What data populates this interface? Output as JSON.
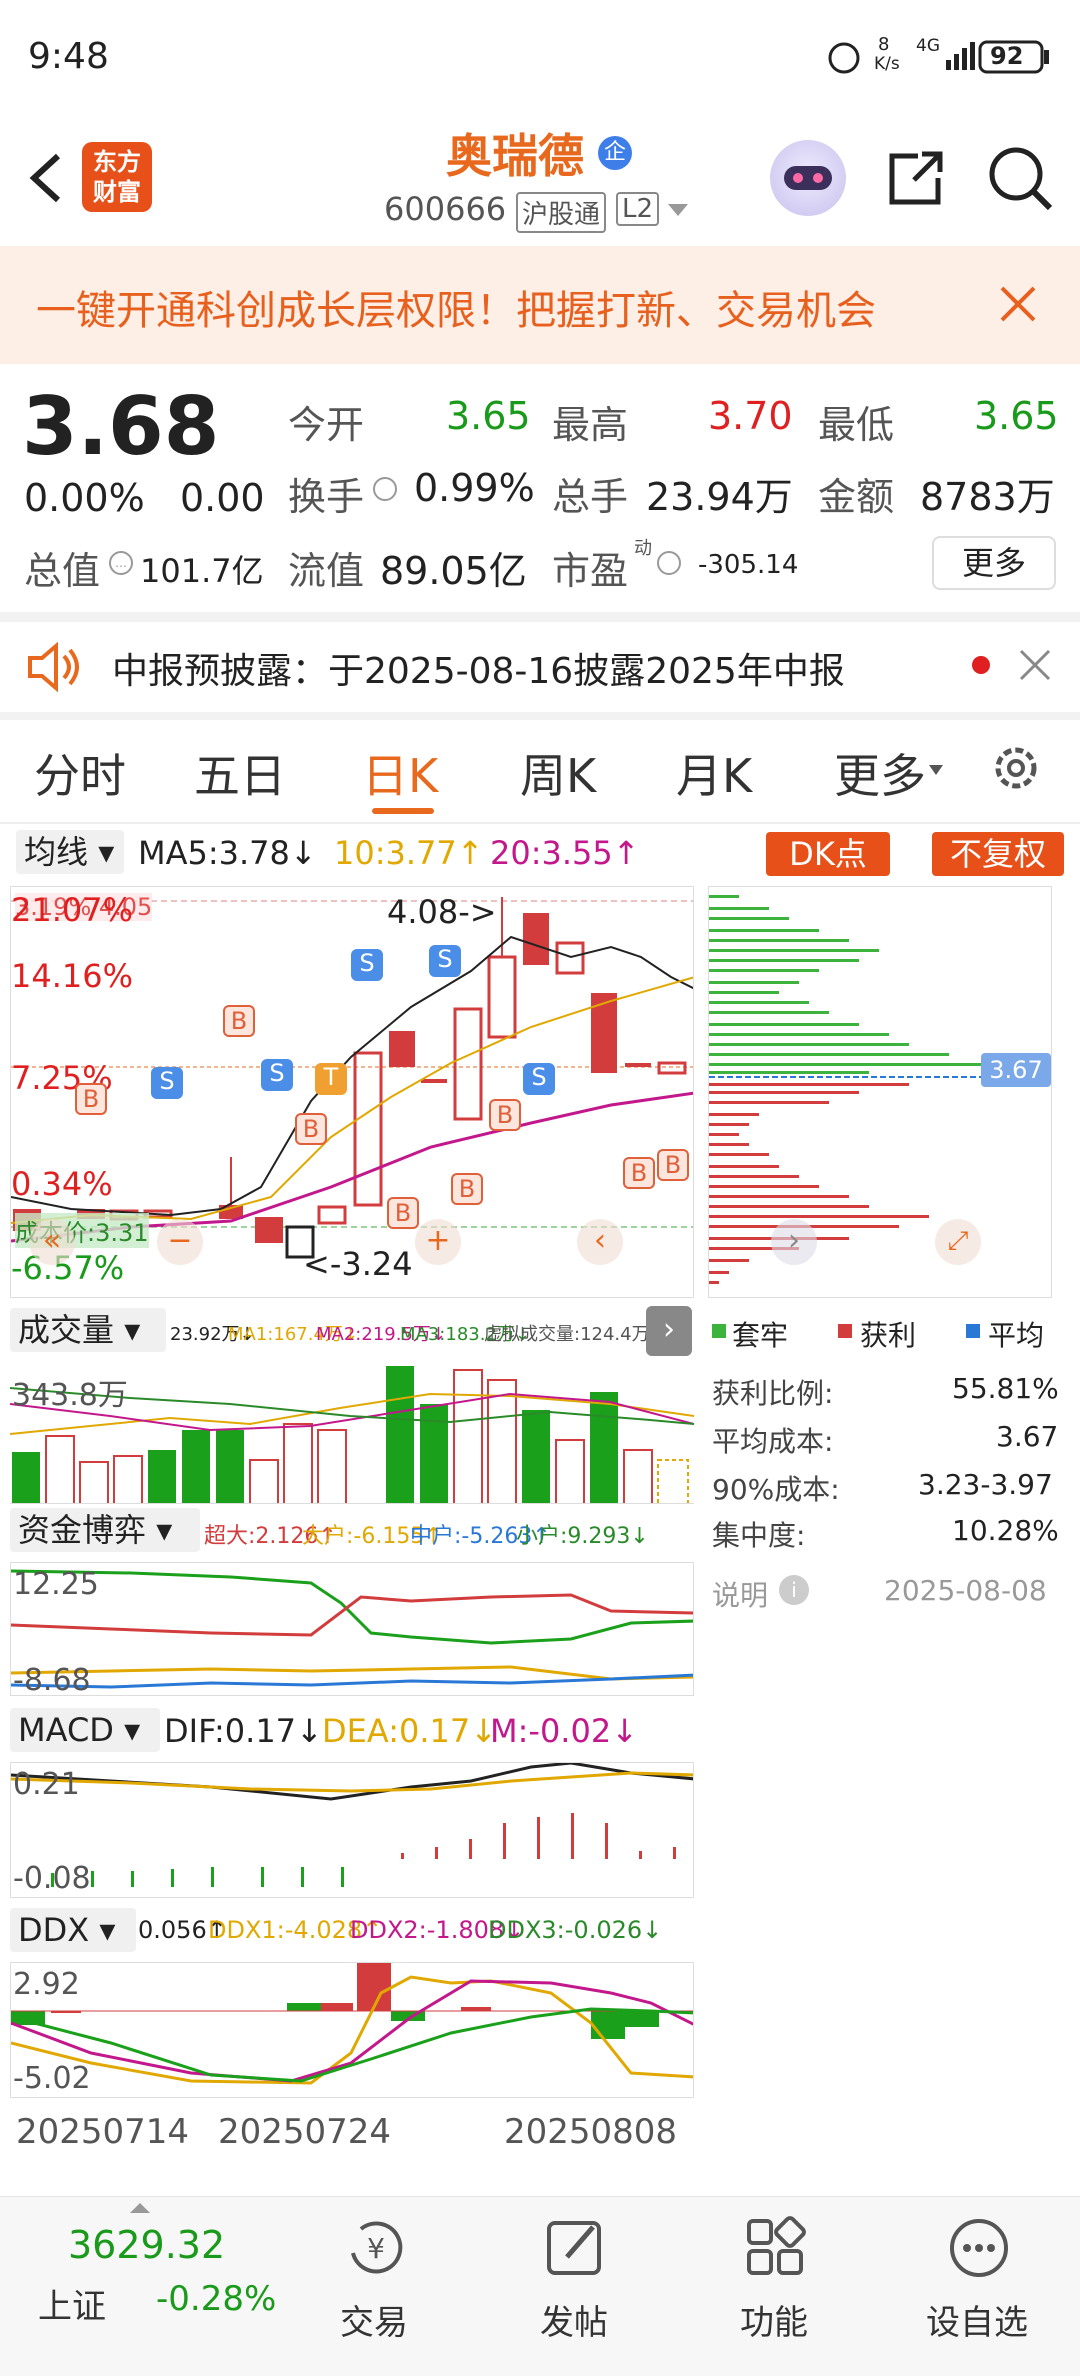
{
  "status_bar": {
    "time": "9:48",
    "speed_value": "8",
    "speed_unit": "K/s",
    "network": "4G",
    "battery": "92"
  },
  "header": {
    "brand_line1": "东方",
    "brand_line2": "财富",
    "stock_name": "奥瑞德",
    "enterprise_badge": "企",
    "stock_code": "600666",
    "exchange_badge": "沪股通",
    "level_badge": "L2"
  },
  "promo_banner": {
    "text": "一键开通科创成长层权限！把握打新、交易机会"
  },
  "quote": {
    "price": "3.68",
    "change_pct": "0.00%",
    "change": "0.00",
    "open_label": "今开",
    "open": "3.65",
    "high_label": "最高",
    "high": "3.70",
    "low_label": "最低",
    "low": "3.65",
    "turnover_label": "换手",
    "turnover": "0.99%",
    "volume_label": "总手",
    "volume": "23.94万",
    "amount_label": "金额",
    "amount": "8783万",
    "mcap_label": "总值",
    "mcap": "101.7亿",
    "float_label": "流值",
    "float_value": "89.05亿",
    "pe_label": "市盈",
    "pe_sup": "动",
    "pe": "-305.14",
    "more_button": "更多"
  },
  "notice": {
    "text": "中报预披露：于2025-08-16披露2025年中报"
  },
  "tabs": [
    "分时",
    "五日",
    "日K",
    "周K",
    "月K",
    "更多"
  ],
  "active_tab": "日K",
  "ma_bar": {
    "selector": "均线",
    "ma5": "MA5:3.78↓",
    "ma10": "10:3.77↑",
    "ma20": "20:3.55↑",
    "dk_button": "DK点",
    "fq_button": "不复权"
  },
  "kline": {
    "pct_labels": [
      "21.07%",
      "14.16%",
      "7.25%",
      "0.34%",
      "-6.57%"
    ],
    "top_overlay": "3.19%  4.05",
    "marker_high": "4.08->",
    "marker_low": "<-3.24",
    "cost_label": "成本价:3.31",
    "markers": [
      "B",
      "S",
      "S",
      "B",
      "B",
      "S",
      "T",
      "S",
      "B",
      "B",
      "B",
      "S",
      "B",
      "B"
    ]
  },
  "chip": {
    "current_label": "3.67",
    "legend": [
      "套牢",
      "获利",
      "平均"
    ],
    "colors": {
      "trapped": "#3cb33c",
      "profit": "#d23c3c",
      "avg": "#2a78d6"
    },
    "rows": [
      {
        "label": "获利比例:",
        "value": "55.81%"
      },
      {
        "label": "平均成本:",
        "value": "3.67"
      },
      {
        "label": "90%成本:",
        "value": "3.23-3.97"
      },
      {
        "label": "集中度:",
        "value": "10.28%"
      }
    ],
    "note_label": "说明",
    "date": "2025-08-08"
  },
  "volume": {
    "selector": "成交量",
    "values": "23.92万↓",
    "ma1": "MA1:167.4万↓",
    "ma2": "MA2:219.5万↓",
    "ma3": "MA3:183.2万↓",
    "virtual": "虚拟成交量:124.4万",
    "axis_label": "343.8万"
  },
  "fund": {
    "selector": "资金博弈",
    "super": "超大:2.126↑",
    "big": "大户:-6.155↑",
    "mid": "中户:-5.263↑",
    "small": "小户:9.293↓",
    "axis_top": "12.25",
    "axis_bottom": "-8.68"
  },
  "macd": {
    "selector": "MACD",
    "dif": "DIF:0.17↓",
    "dea": "DEA:0.17↓",
    "m": "M:-0.02↓",
    "axis_top": "0.21",
    "axis_bottom": "-0.08"
  },
  "ddx": {
    "selector": "DDX",
    "value": "0.056↑",
    "ddx1": "DDX1:-4.028↑",
    "ddx2": "DDX2:-1.808↓",
    "ddx3": "DDX3:-0.026↓",
    "axis_top": "2.92",
    "axis_bottom": "-5.02"
  },
  "dates": [
    "20250714",
    "20250724",
    "20250808"
  ],
  "bottom_nav": {
    "index_value": "3629.32",
    "index_name": "上证",
    "index_change": "-0.28%",
    "items": [
      "交易",
      "发帖",
      "功能",
      "设自选"
    ]
  }
}
